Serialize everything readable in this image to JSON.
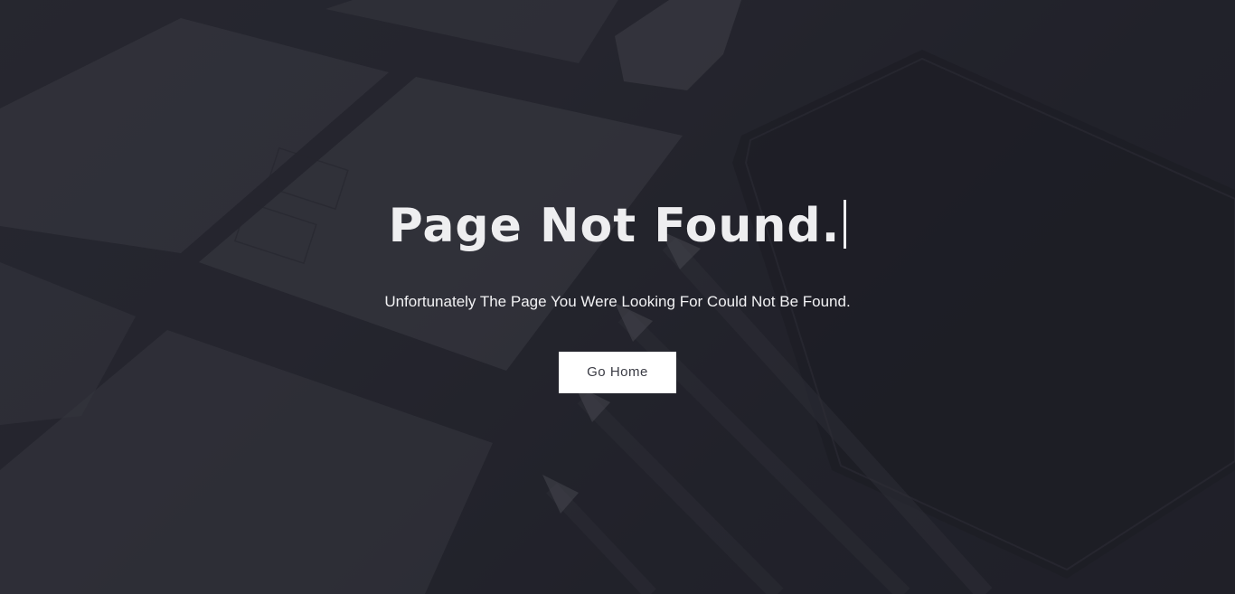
{
  "error_page": {
    "title": "Page Not Found.",
    "message": "Unfortunately The Page You Were Looking For Could Not Be Found.",
    "home_button_label": "Go Home"
  },
  "colors": {
    "background": "#24252d",
    "overlay": "#20212a",
    "title_text": "#eeeef0",
    "button_bg": "#ffffff",
    "button_text": "#3a3b44"
  }
}
